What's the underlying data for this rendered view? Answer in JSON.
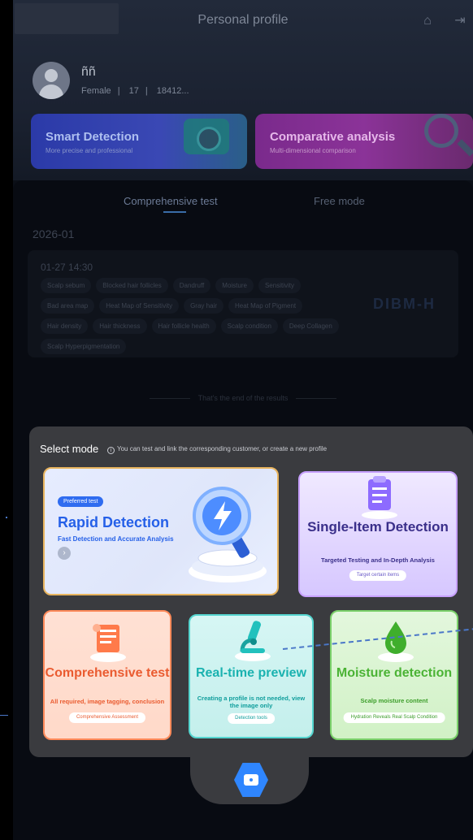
{
  "background": {
    "nav_title": "Personal profile",
    "user": {
      "name": "ññ",
      "gender": "Female",
      "age": "17",
      "phone": "18412..."
    },
    "top_cards": [
      {
        "title": "Smart Detection",
        "subtitle": "More precise and professional"
      },
      {
        "title": "Comparative analysis",
        "subtitle": "Multi-dimensional comparison"
      }
    ],
    "tabs": [
      {
        "label": "Comprehensive test"
      },
      {
        "label": "Free mode"
      }
    ],
    "month": "2026-01",
    "record": {
      "time": "01-27 14:30",
      "watermark": "DIBM-H",
      "tags": [
        "Scalp sebum",
        "Blocked hair follicles",
        "Dandruff",
        "Moisture",
        "Sensitivity",
        "Bad area map",
        "Heat Map of Sensitivity",
        "Gray hair",
        "Heat Map of Pigment",
        "Hair density",
        "Hair thickness",
        "Hair follicle health",
        "Scalp condition",
        "Deep Collagen",
        "Scalp Hyperpigmentation"
      ]
    },
    "end_text": "That's the end of the results"
  },
  "modal": {
    "title": "Select mode",
    "hint": "You can test and link the corresponding customer, or create a new profile",
    "cards": {
      "rapid": {
        "badge": "Preferred test",
        "title": "Rapid Detection",
        "subtitle": "Fast Detection and Accurate Analysis"
      },
      "single": {
        "title": "Single-Item Detection",
        "subtitle": "Targeted Testing and In-Depth Analysis",
        "button": "Target certain items"
      },
      "comprehensive": {
        "title": "Comprehensive test",
        "subtitle": "All required, image tagging, conclusion",
        "button": "Comprehensive Assessment"
      },
      "realtime": {
        "title": "Real-time preview",
        "subtitle": "Creating a profile is not needed, view the image only",
        "button": "Detection tools"
      },
      "moisture": {
        "title": "Moisture detection",
        "subtitle": "Scalp moisture content",
        "button": "Hydration Reveals Real Scalp Condition"
      }
    }
  },
  "icons": {
    "home": "home-icon",
    "logout": "logout-icon",
    "camera": "camera-icon",
    "info": "info-icon"
  },
  "colors": {
    "accent_blue": "#2f86ff",
    "rapid": "#2560e8",
    "single": "#3a2f8a",
    "comprehensive": "#ea5b30",
    "realtime": "#1ab2b0",
    "moisture": "#4bb335"
  }
}
